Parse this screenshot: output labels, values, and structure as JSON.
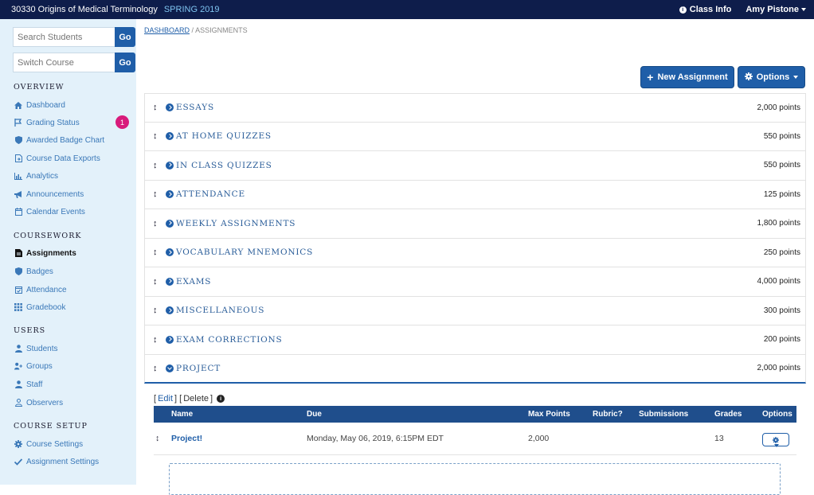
{
  "topbar": {
    "course": "30330  Origins of Medical Terminology",
    "term": "SPRING 2019",
    "class_info": "Class Info",
    "user": "Amy Pistone"
  },
  "sidebar": {
    "search_students_placeholder": "Search Students",
    "switch_course_placeholder": "Switch Course",
    "go_label": "Go",
    "sections": {
      "overview": "OVERVIEW",
      "coursework": "COURSEWORK",
      "users": "USERS",
      "course_setup": "COURSE SETUP"
    },
    "items": {
      "dashboard": "Dashboard",
      "grading_status": "Grading Status",
      "grading_status_count": "1",
      "awarded_badge_chart": "Awarded Badge Chart",
      "course_data_exports": "Course Data Exports",
      "analytics": "Analytics",
      "announcements": "Announcements",
      "calendar_events": "Calendar Events",
      "assignments": "Assignments",
      "badges": "Badges",
      "attendance": "Attendance",
      "gradebook": "Gradebook",
      "students": "Students",
      "groups": "Groups",
      "staff": "Staff",
      "observers": "Observers",
      "course_settings": "Course Settings",
      "assignment_settings": "Assignment Settings"
    }
  },
  "breadcrumb": {
    "dashboard": "DASHBOARD",
    "separator": "/",
    "current": "ASSIGNMENTS"
  },
  "actions": {
    "new_assignment": "New Assignment",
    "options": "Options"
  },
  "categories": [
    {
      "name": "ESSAYS",
      "points": "2,000 points"
    },
    {
      "name": "AT HOME QUIZZES",
      "points": "550 points"
    },
    {
      "name": "IN CLASS QUIZZES",
      "points": "550 points"
    },
    {
      "name": "ATTENDANCE",
      "points": "125 points"
    },
    {
      "name": "WEEKLY ASSIGNMENTS",
      "points": "1,800 points"
    },
    {
      "name": "VOCABULARY MNEMONICS",
      "points": "250 points"
    },
    {
      "name": "EXAMS",
      "points": "4,000 points"
    },
    {
      "name": "MISCELLANEOUS",
      "points": "300 points"
    },
    {
      "name": "EXAM CORRECTIONS",
      "points": "200 points"
    },
    {
      "name": "PROJECT",
      "points": "2,000 points"
    }
  ],
  "expanded": {
    "edit": "Edit",
    "delete": "Delete",
    "columns": [
      "Name",
      "Due",
      "Max Points",
      "Rubric?",
      "Submissions",
      "Grades",
      "Options"
    ],
    "row": {
      "name": "Project!",
      "due": "Monday, May 06, 2019, 6:15PM EDT",
      "max_points": "2,000",
      "rubric": "",
      "submissions": "",
      "grades": "13"
    }
  },
  "colors": {
    "topbar": "#0e1d4b",
    "sidebar": "#e3f1fa",
    "accent": "#1f5ea8",
    "badge": "#d81b7b"
  }
}
